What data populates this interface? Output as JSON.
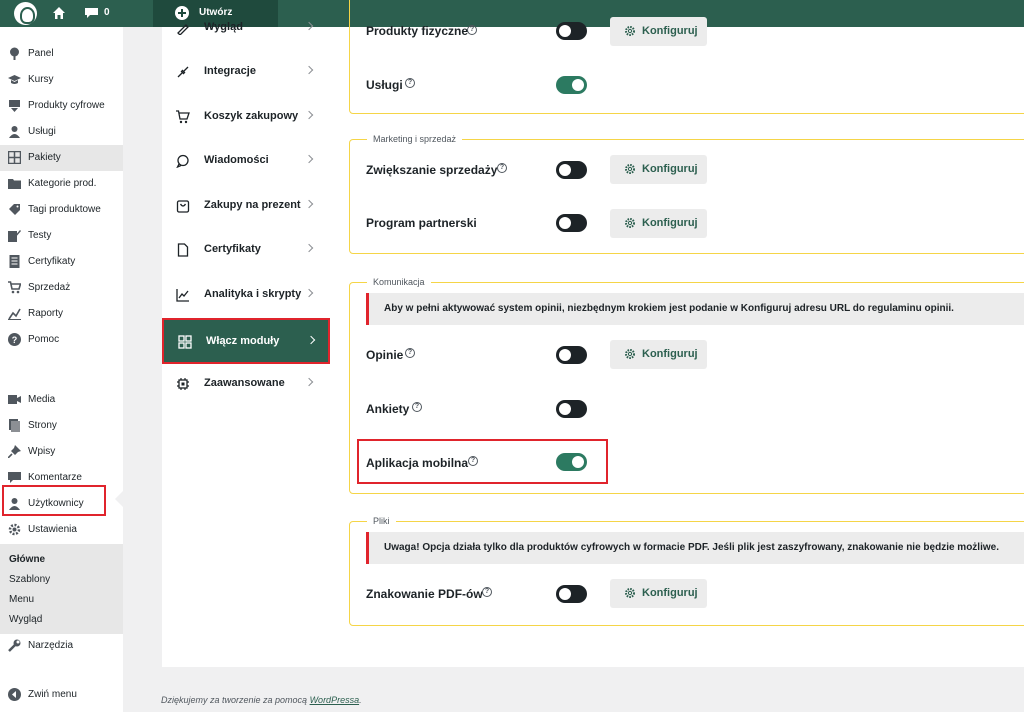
{
  "topbar": {
    "comments_count": "0",
    "create_label": "Utwórz"
  },
  "sidebar": {
    "items": [
      {
        "label": "Panel",
        "icon": "dashboard-icon"
      },
      {
        "label": "Kursy",
        "icon": "graduation-cap-icon"
      },
      {
        "label": "Produkty cyfrowe",
        "icon": "download-icon"
      },
      {
        "label": "Usługi",
        "icon": "user-icon"
      },
      {
        "label": "Pakiety",
        "icon": "grid-icon"
      },
      {
        "label": "Kategorie prod.",
        "icon": "folder-icon"
      },
      {
        "label": "Tagi produktowe",
        "icon": "tag-icon"
      },
      {
        "label": "Testy",
        "icon": "edit-icon"
      },
      {
        "label": "Certyfikaty",
        "icon": "document-icon"
      },
      {
        "label": "Sprzedaż",
        "icon": "cart-icon"
      },
      {
        "label": "Raporty",
        "icon": "chart-icon"
      },
      {
        "label": "Pomoc",
        "icon": "help-icon"
      },
      {
        "label": "Media",
        "icon": "media-icon"
      },
      {
        "label": "Strony",
        "icon": "page-icon"
      },
      {
        "label": "Wpisy",
        "icon": "pin-icon"
      },
      {
        "label": "Komentarze",
        "icon": "comment-icon"
      },
      {
        "label": "Użytkownicy",
        "icon": "users-icon"
      },
      {
        "label": "Ustawienia",
        "icon": "settings-icon"
      }
    ],
    "submenu": [
      "Główne",
      "Szablony",
      "Menu",
      "Wygląd"
    ],
    "tools": "Narzędzia",
    "collapse": "Zwiń menu"
  },
  "settings_nav": [
    {
      "label": "Wygląd",
      "icon": "brush-icon"
    },
    {
      "label": "Integracje",
      "icon": "plug-icon"
    },
    {
      "label": "Koszyk zakupowy",
      "icon": "cart-icon"
    },
    {
      "label": "Wiadomości",
      "icon": "message-icon"
    },
    {
      "label": "Zakupy na prezent",
      "icon": "gift-icon"
    },
    {
      "label": "Certyfikaty",
      "icon": "file-icon"
    },
    {
      "label": "Analityka i skrypty",
      "icon": "analytics-icon"
    },
    {
      "label": "Włącz moduły",
      "icon": "modules-icon",
      "active": true
    },
    {
      "label": "Zaawansowane",
      "icon": "chip-icon"
    }
  ],
  "sections": {
    "produkty": {
      "rows": [
        {
          "label": "Produkty fizyczne",
          "enabled": false,
          "configure": "Konfiguruj"
        },
        {
          "label": "Usługi",
          "enabled": true
        }
      ]
    },
    "marketing": {
      "legend": "Marketing i sprzedaż",
      "rows": [
        {
          "label": "Zwiększanie sprzedaży",
          "enabled": false,
          "configure": "Konfiguruj"
        },
        {
          "label": "Program partnerski",
          "enabled": false,
          "configure": "Konfiguruj"
        }
      ]
    },
    "komunikacja": {
      "legend": "Komunikacja",
      "notice": "Aby w pełni aktywować system opinii, niezbędnym krokiem jest podanie w Konfiguruj adresu URL do regulaminu opinii.",
      "rows": [
        {
          "label": "Opinie",
          "enabled": false,
          "configure": "Konfiguruj"
        },
        {
          "label": "Ankiety",
          "enabled": false
        },
        {
          "label": "Aplikacja mobilna",
          "enabled": true
        }
      ]
    },
    "pliki": {
      "legend": "Pliki",
      "notice": "Uwaga! Opcja działa tylko dla produktów cyfrowych w formacie PDF. Jeśli plik jest zaszyfrowany, znakowanie nie będzie możliwe.",
      "rows": [
        {
          "label": "Znakowanie PDF-ów",
          "enabled": false,
          "configure": "Konfiguruj"
        }
      ]
    }
  },
  "footer": {
    "text": "Dziękujemy za tworzenie za pomocą ",
    "link": "WordPressa",
    "suffix": "."
  }
}
